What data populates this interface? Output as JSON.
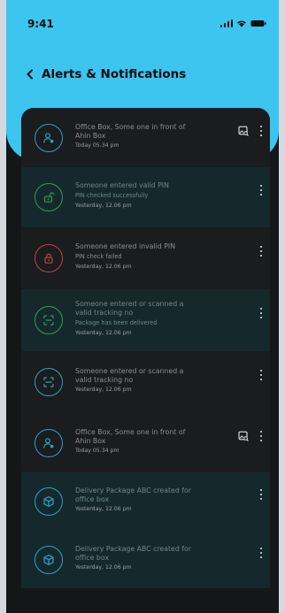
{
  "status_bar": {
    "time": "9:41"
  },
  "header": {
    "title": "Alerts & Notifications"
  },
  "colors": {
    "accent": "#3cc5ee",
    "background": "#141618",
    "success": "#2e9e53",
    "danger": "#c24444"
  },
  "notifications": [
    {
      "icon": "person-user-icon",
      "line1": "Office Box, Some one in front of",
      "line2": "Ahin Box",
      "sub": "",
      "time": "Today 05.34 pm",
      "has_camera": true,
      "style": "dark",
      "ring": "blue"
    },
    {
      "icon": "unlock-icon",
      "line1": "Someone entered valid PIN",
      "line2": "",
      "sub": "PIN checked successfully",
      "time": "Yesterday, 12.06 pm",
      "has_camera": false,
      "style": "teal",
      "ring": "green"
    },
    {
      "icon": "lock-icon",
      "line1": "Someone entered invalid PIN",
      "line2": "",
      "sub": "PIN check failed",
      "time": "Yesterday, 12.06 pm",
      "has_camera": false,
      "style": "dark",
      "ring": "red"
    },
    {
      "icon": "scan-icon",
      "line1": "Someone entered or scanned a",
      "line2": "valid tracking no",
      "sub": "Package has been delivered",
      "time": "Yesterday, 12.06 pm",
      "has_camera": false,
      "style": "teal",
      "ring": "green"
    },
    {
      "icon": "scan-icon",
      "line1": "Someone entered or scanned a",
      "line2": "valid tracking no",
      "sub": "",
      "time": "Yesterday, 12.06 pm",
      "has_camera": false,
      "style": "dark",
      "ring": "blue"
    },
    {
      "icon": "person-user-icon",
      "line1": "Office Box, Some one in front of",
      "line2": "Ahin Box",
      "sub": "",
      "time": "Today 05.34 pm",
      "has_camera": true,
      "style": "dark",
      "ring": "blue"
    },
    {
      "icon": "package-icon",
      "line1": "Delivery Package ABC created for",
      "line2": "office box",
      "sub": "",
      "time": "Yesterday, 12.06 pm",
      "has_camera": false,
      "style": "teal",
      "ring": "blue"
    },
    {
      "icon": "package-icon",
      "line1": "Delivery Package ABC created for",
      "line2": "office box",
      "sub": "",
      "time": "Yesterday, 12.06 pm",
      "has_camera": false,
      "style": "teal",
      "ring": "blue"
    }
  ]
}
